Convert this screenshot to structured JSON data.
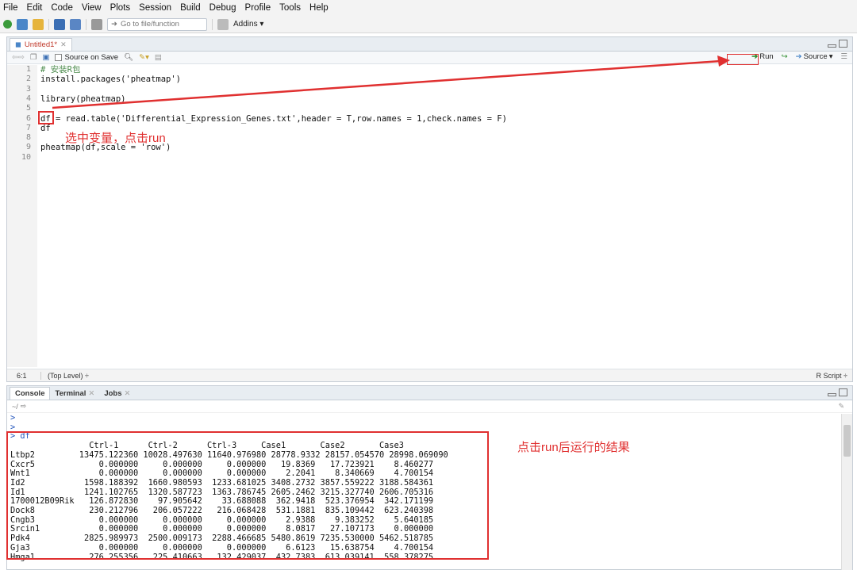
{
  "menu": [
    "File",
    "Edit",
    "Code",
    "View",
    "Plots",
    "Session",
    "Build",
    "Debug",
    "Profile",
    "Tools",
    "Help"
  ],
  "toolbar": {
    "goto_placeholder": "Go to file/function",
    "addins_label": "Addins ▾"
  },
  "editor": {
    "tab_title": "Untitled1*",
    "source_on_save": "Source on Save",
    "run_label": "Run",
    "source_label": "Source",
    "lines": [
      {
        "num": "1",
        "text": "# 安装R包"
      },
      {
        "num": "2",
        "text": "install.packages('pheatmap')"
      },
      {
        "num": "3",
        "text": ""
      },
      {
        "num": "4",
        "text": "library(pheatmap)"
      },
      {
        "num": "5",
        "text": ""
      },
      {
        "num": "6",
        "text": "df = read.table('Differential_Expression_Genes.txt',header = T,row.names = 1,check.names = F)"
      },
      {
        "num": "7",
        "text": "df"
      },
      {
        "num": "8",
        "text": ""
      },
      {
        "num": "9",
        "text": "pheatmap(df,scale = 'row')"
      },
      {
        "num": "10",
        "text": ""
      }
    ],
    "status_position": "6:1",
    "status_level": "(Top Level) ÷",
    "status_lang": "R Script ÷"
  },
  "console": {
    "tabs": [
      "Console",
      "Terminal",
      "Jobs"
    ],
    "path": "~/",
    "lines": [
      ">",
      ">",
      "> df",
      "                Ctrl-1      Ctrl-2      Ctrl-3     Case1       Case2       Case3",
      "Ltbp2         13475.122360 10028.497630 11640.976980 28778.9332 28157.054570 28998.069090",
      "Cxcr5             0.000000     0.000000     0.000000   19.8369   17.723921    8.460277",
      "Wnt1              0.000000     0.000000     0.000000    2.2041    8.340669    4.700154",
      "Id2            1598.188392  1660.980593  1233.681025 3408.2732 3857.559222 3188.584361",
      "Id1            1241.102765  1320.587723  1363.786745 2605.2462 3215.327740 2606.705316",
      "1700012B09Rik   126.872830    97.905642    33.688088  362.9418  523.376954  342.171199",
      "Dock8           230.212796   206.057222   216.068428  531.1881  835.109442  623.240398",
      "Cngb3             0.000000     0.000000     0.000000    2.9388    9.383252    5.640185",
      "Srcin1            0.000000     0.000000     0.000000    8.0817   27.107173    0.000000",
      "Pdk4           2825.989973  2500.009173  2288.466685 5480.8619 7235.530000 5462.518785",
      "Gja3              0.000000     0.000000     0.000000    6.6123   15.638754    4.700154",
      "Hmga1           276.255356   225.410663   132.429037  432.7383  613.039141  558.378275"
    ]
  },
  "annotations": {
    "select_variable": "选中变量，点击run",
    "result": "点击run后运行的结果"
  },
  "colors": {
    "annotation": "#e03030",
    "accent": "#2255bb"
  }
}
